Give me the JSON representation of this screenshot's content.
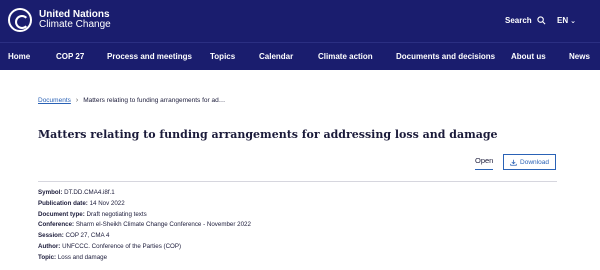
{
  "header": {
    "org_line1": "United Nations",
    "org_line2": "Climate Change",
    "search_label": "Search",
    "language": "EN"
  },
  "nav": {
    "items": [
      "Home",
      "COP 27",
      "Process and meetings",
      "Topics",
      "Calendar",
      "Climate action",
      "Documents and decisions",
      "About us",
      "News"
    ]
  },
  "breadcrumb": {
    "link": "Documents",
    "current": "Matters relating to funding arrangements for ad…"
  },
  "document": {
    "title": "Matters relating to funding arrangements for addressing loss and damage",
    "open_label": "Open",
    "download_label": "Download",
    "meta": [
      {
        "label": "Symbol:",
        "value": "DT.DD.CMA4.i8f.1"
      },
      {
        "label": "Publication date:",
        "value": "14 Nov 2022"
      },
      {
        "label": "Document type:",
        "value": "Draft negotiating texts"
      },
      {
        "label": "Conference:",
        "value": "Sharm el-Sheikh Climate Change Conference - November 2022"
      },
      {
        "label": "Session:",
        "value": "COP 27, CMA 4"
      },
      {
        "label": "Author:",
        "value": "UNFCCC. Conference of the Parties (COP)"
      },
      {
        "label": "Topic:",
        "value": "Loss and damage"
      }
    ]
  },
  "colors": {
    "header_bg": "#1a1d6e",
    "link": "#2a62b6"
  },
  "icons": [
    "unfccc-logo-icon",
    "search-icon",
    "chevron-down-icon",
    "breadcrumb-chevron-icon",
    "download-icon"
  ]
}
